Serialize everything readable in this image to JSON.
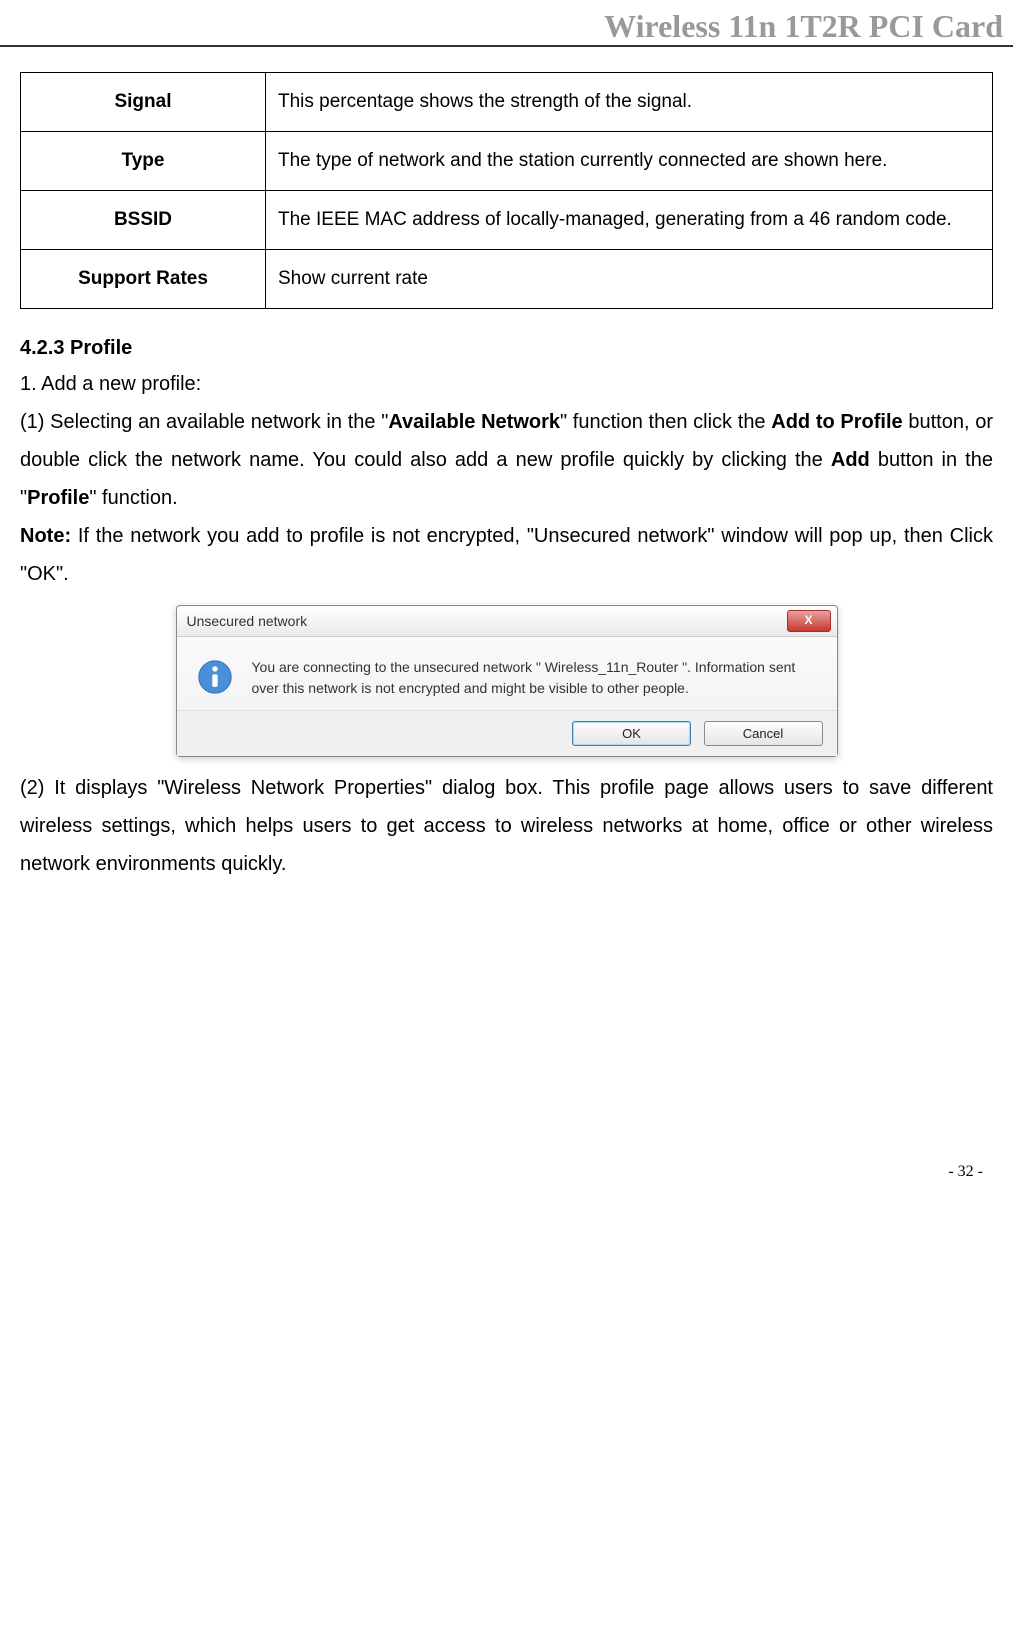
{
  "header": {
    "title": "Wireless 11n 1T2R PCI Card"
  },
  "table": {
    "rows": [
      {
        "label": "Signal",
        "desc": "This percentage shows the strength of the signal."
      },
      {
        "label": "Type",
        "desc": "The type of network and the station currently connected are shown here."
      },
      {
        "label": "BSSID",
        "desc": "The IEEE MAC address of locally-managed, generating from a 46 random code."
      },
      {
        "label": "Support Rates",
        "desc": "Show current rate"
      }
    ]
  },
  "section": {
    "heading": "4.2.3 Profile",
    "line1": "1. Add a new profile:",
    "para1_a": "(1) Selecting an available network in the \"",
    "para1_b": "Available Network",
    "para1_c": "\" function then click the ",
    "para1_d": "Add to Profile",
    "para1_e": " button, or double click the network name. You could also add a new profile quickly by clicking the ",
    "para1_f": "Add",
    "para1_g": " button in the \"",
    "para1_h": "Profile",
    "para1_i": "\" function.",
    "note_label": "Note:",
    "note_text_a": " If the network you add to profile is not encrypted, \"Unsecured network\" window will pop up, then Click \"OK\".",
    "para2": "(2) It displays \"Wireless Network Properties\" dialog box. This profile page allows users to save different wireless settings, which helps users to get access to wireless networks at home, office or other wireless network environments quickly."
  },
  "dialog": {
    "title": "Unsecured network",
    "close": "X",
    "message": "You are connecting to the unsecured network \" Wireless_11n_Router \". Information sent over this network is not encrypted and might be visible to other people.",
    "ok": "OK",
    "cancel": "Cancel"
  },
  "footer": {
    "page": "- 32 -"
  }
}
